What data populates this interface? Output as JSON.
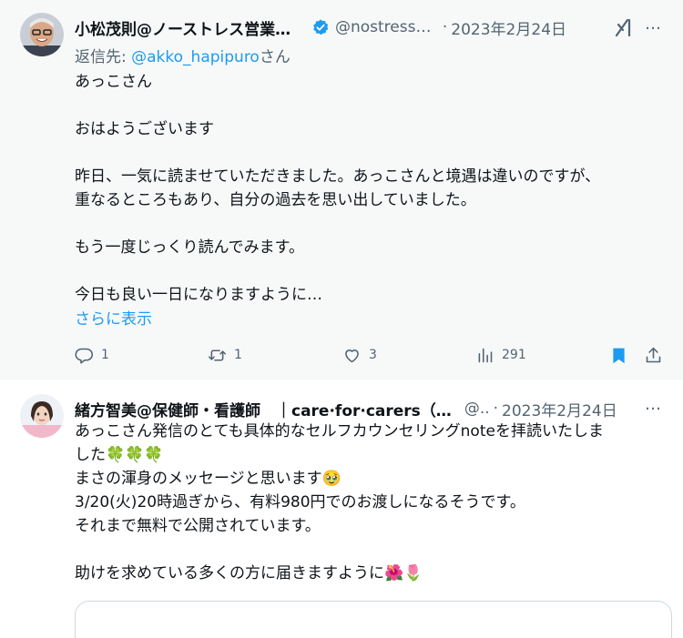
{
  "tweet1": {
    "author_name": "小松茂則@ノーストレス営業の…",
    "handle": "@nostress_…",
    "dot": "·",
    "date": "2023年2月24日",
    "reply_prefix": "返信先: ",
    "reply_mention": "@akko_hapipuro",
    "reply_suffix": "さん",
    "paragraphs": [
      "あっこさん",
      "おはようございます",
      "昨日、一気に読ませていただきました。あっこさんと境遇は違いのですが、\n重なるところもあり、自分の過去を思い出していました。",
      "もう一度じっくり読んでみます。",
      "今日も良い一日になりますように…"
    ],
    "show_more": "さらに表示",
    "replies": "1",
    "retweets": "1",
    "likes": "3",
    "views": "291",
    "more_icon": "…"
  },
  "tweet2": {
    "author_name": "緒方智美@保健師・看護師　｜care·for·carers（…",
    "handle": "@..",
    "dot": "·",
    "date": "2023年2月24日",
    "paragraphs": [
      "あっこさん発信のとても具体的なセルフカウンセリングnoteを拝読いたしま\nした🍀🍀🍀\nまさの渾身のメッセージと思います🥹\n3/20(火)20時過ぎから、有料980円でのお渡しになるそうです。\nそれまで無料で公開されています。",
      "助けを求めている多くの方に届きますように🌺🌷"
    ],
    "more_icon": "…"
  },
  "colors": {
    "accent": "#1d9bf0",
    "muted": "#536471",
    "text": "#0f1419",
    "selected_bg": "#f7f9f9"
  },
  "icons": [
    "verified-badge-icon",
    "grok-icon",
    "more-icon",
    "reply-icon",
    "retweet-icon",
    "like-icon",
    "views-icon",
    "bookmark-icon",
    "share-icon"
  ]
}
